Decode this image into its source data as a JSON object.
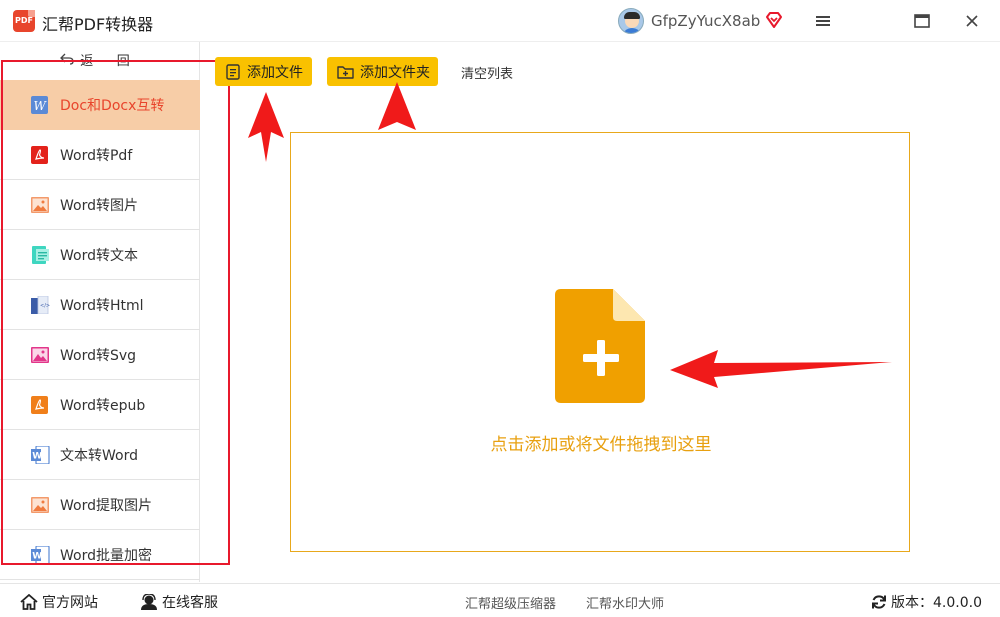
{
  "app": {
    "title": "汇帮PDF转换器",
    "logo_text": "PDF"
  },
  "user": {
    "name": "GfpZyYucX8ab"
  },
  "sidebar": {
    "back_label": "返 回",
    "items": [
      {
        "label": "Doc和Docx互转",
        "icon": "word-doc-icon",
        "active": true
      },
      {
        "label": "Word转Pdf",
        "icon": "pdf-icon"
      },
      {
        "label": "Word转图片",
        "icon": "image-icon"
      },
      {
        "label": "Word转文本",
        "icon": "text-file-icon"
      },
      {
        "label": "Word转Html",
        "icon": "html-icon"
      },
      {
        "label": "Word转Svg",
        "icon": "svg-image-icon"
      },
      {
        "label": "Word转epub",
        "icon": "epub-icon"
      },
      {
        "label": "文本转Word",
        "icon": "word-icon"
      },
      {
        "label": "Word提取图片",
        "icon": "image-icon"
      },
      {
        "label": "Word批量加密",
        "icon": "word-icon"
      }
    ]
  },
  "toolbar": {
    "add_file_label": "添加文件",
    "add_folder_label": "添加文件夹",
    "clear_label": "清空列表"
  },
  "dropzone": {
    "text": "点击添加或将文件拖拽到这里"
  },
  "bottombar": {
    "site_label": "官方网站",
    "support_label": "在线客服",
    "promo1": "汇帮超级压缩器",
    "promo2": "汇帮水印大师",
    "version": "版本：4.0.0.0"
  },
  "colors": {
    "accent": "#f9c100",
    "active_bg": "#f7cda7",
    "active_text": "#e8452c",
    "dropzone_border": "#e8a81b",
    "annotation_red": "#e8192c"
  }
}
